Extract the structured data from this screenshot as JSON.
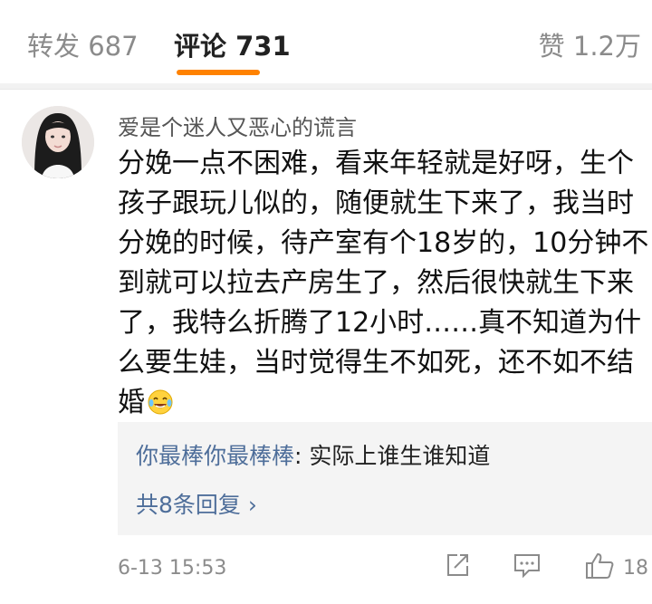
{
  "tabs": {
    "repost": "转发 687",
    "comments": "评论 731",
    "likes": "赞 1.2万",
    "accent_color": "#ff8200"
  },
  "comment": {
    "username": "爱是个迷人又恶心的谎言",
    "text": "分娩一点不困难，看来年轻就是好呀，生个孩子跟玩儿似的，随便就生下来了，我当时分娩的时候，待产室有个18岁的，10分钟不到就可以拉去产房生了，然后很快就生下来了，我特么折腾了12小时……真不知道为什么要生娃，当时觉得生不如死，还不如不结婚",
    "emoji": "laughing-crying-emoji",
    "reply_preview": {
      "user": "你最棒你最棒棒",
      "separator": ":",
      "text": " 实际上谁生谁知道"
    },
    "more_replies": "共8条回复 ",
    "more_replies_arrow": "›",
    "time": "6-13 15:53",
    "like_count": "18"
  },
  "colors": {
    "link": "#4e6e9a",
    "muted": "#8b8b8b",
    "reply_bg": "#f4f4f4"
  }
}
